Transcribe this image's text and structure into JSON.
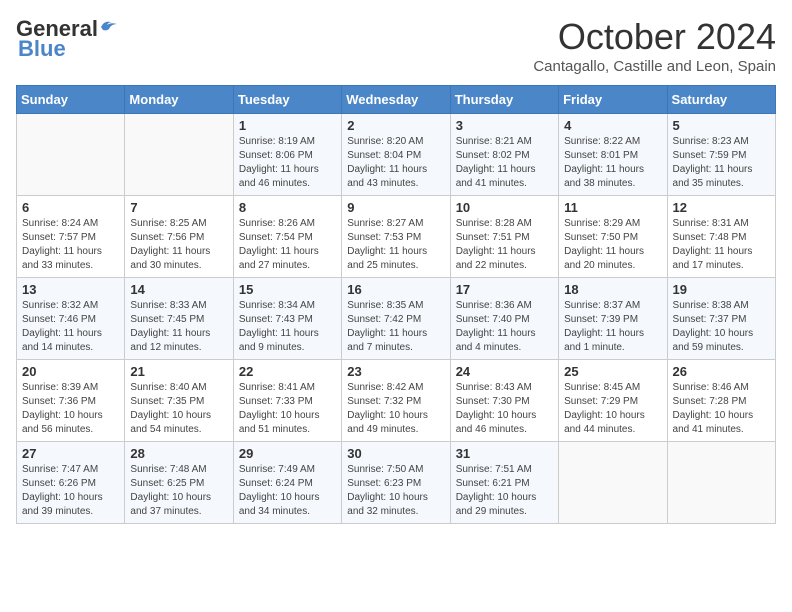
{
  "logo": {
    "general": "General",
    "blue": "Blue"
  },
  "title": "October 2024",
  "location": "Cantagallo, Castille and Leon, Spain",
  "days_of_week": [
    "Sunday",
    "Monday",
    "Tuesday",
    "Wednesday",
    "Thursday",
    "Friday",
    "Saturday"
  ],
  "weeks": [
    [
      {
        "day": "",
        "sunrise": "",
        "sunset": "",
        "daylight": ""
      },
      {
        "day": "",
        "sunrise": "",
        "sunset": "",
        "daylight": ""
      },
      {
        "day": "1",
        "sunrise": "Sunrise: 8:19 AM",
        "sunset": "Sunset: 8:06 PM",
        "daylight": "Daylight: 11 hours and 46 minutes."
      },
      {
        "day": "2",
        "sunrise": "Sunrise: 8:20 AM",
        "sunset": "Sunset: 8:04 PM",
        "daylight": "Daylight: 11 hours and 43 minutes."
      },
      {
        "day": "3",
        "sunrise": "Sunrise: 8:21 AM",
        "sunset": "Sunset: 8:02 PM",
        "daylight": "Daylight: 11 hours and 41 minutes."
      },
      {
        "day": "4",
        "sunrise": "Sunrise: 8:22 AM",
        "sunset": "Sunset: 8:01 PM",
        "daylight": "Daylight: 11 hours and 38 minutes."
      },
      {
        "day": "5",
        "sunrise": "Sunrise: 8:23 AM",
        "sunset": "Sunset: 7:59 PM",
        "daylight": "Daylight: 11 hours and 35 minutes."
      }
    ],
    [
      {
        "day": "6",
        "sunrise": "Sunrise: 8:24 AM",
        "sunset": "Sunset: 7:57 PM",
        "daylight": "Daylight: 11 hours and 33 minutes."
      },
      {
        "day": "7",
        "sunrise": "Sunrise: 8:25 AM",
        "sunset": "Sunset: 7:56 PM",
        "daylight": "Daylight: 11 hours and 30 minutes."
      },
      {
        "day": "8",
        "sunrise": "Sunrise: 8:26 AM",
        "sunset": "Sunset: 7:54 PM",
        "daylight": "Daylight: 11 hours and 27 minutes."
      },
      {
        "day": "9",
        "sunrise": "Sunrise: 8:27 AM",
        "sunset": "Sunset: 7:53 PM",
        "daylight": "Daylight: 11 hours and 25 minutes."
      },
      {
        "day": "10",
        "sunrise": "Sunrise: 8:28 AM",
        "sunset": "Sunset: 7:51 PM",
        "daylight": "Daylight: 11 hours and 22 minutes."
      },
      {
        "day": "11",
        "sunrise": "Sunrise: 8:29 AM",
        "sunset": "Sunset: 7:50 PM",
        "daylight": "Daylight: 11 hours and 20 minutes."
      },
      {
        "day": "12",
        "sunrise": "Sunrise: 8:31 AM",
        "sunset": "Sunset: 7:48 PM",
        "daylight": "Daylight: 11 hours and 17 minutes."
      }
    ],
    [
      {
        "day": "13",
        "sunrise": "Sunrise: 8:32 AM",
        "sunset": "Sunset: 7:46 PM",
        "daylight": "Daylight: 11 hours and 14 minutes."
      },
      {
        "day": "14",
        "sunrise": "Sunrise: 8:33 AM",
        "sunset": "Sunset: 7:45 PM",
        "daylight": "Daylight: 11 hours and 12 minutes."
      },
      {
        "day": "15",
        "sunrise": "Sunrise: 8:34 AM",
        "sunset": "Sunset: 7:43 PM",
        "daylight": "Daylight: 11 hours and 9 minutes."
      },
      {
        "day": "16",
        "sunrise": "Sunrise: 8:35 AM",
        "sunset": "Sunset: 7:42 PM",
        "daylight": "Daylight: 11 hours and 7 minutes."
      },
      {
        "day": "17",
        "sunrise": "Sunrise: 8:36 AM",
        "sunset": "Sunset: 7:40 PM",
        "daylight": "Daylight: 11 hours and 4 minutes."
      },
      {
        "day": "18",
        "sunrise": "Sunrise: 8:37 AM",
        "sunset": "Sunset: 7:39 PM",
        "daylight": "Daylight: 11 hours and 1 minute."
      },
      {
        "day": "19",
        "sunrise": "Sunrise: 8:38 AM",
        "sunset": "Sunset: 7:37 PM",
        "daylight": "Daylight: 10 hours and 59 minutes."
      }
    ],
    [
      {
        "day": "20",
        "sunrise": "Sunrise: 8:39 AM",
        "sunset": "Sunset: 7:36 PM",
        "daylight": "Daylight: 10 hours and 56 minutes."
      },
      {
        "day": "21",
        "sunrise": "Sunrise: 8:40 AM",
        "sunset": "Sunset: 7:35 PM",
        "daylight": "Daylight: 10 hours and 54 minutes."
      },
      {
        "day": "22",
        "sunrise": "Sunrise: 8:41 AM",
        "sunset": "Sunset: 7:33 PM",
        "daylight": "Daylight: 10 hours and 51 minutes."
      },
      {
        "day": "23",
        "sunrise": "Sunrise: 8:42 AM",
        "sunset": "Sunset: 7:32 PM",
        "daylight": "Daylight: 10 hours and 49 minutes."
      },
      {
        "day": "24",
        "sunrise": "Sunrise: 8:43 AM",
        "sunset": "Sunset: 7:30 PM",
        "daylight": "Daylight: 10 hours and 46 minutes."
      },
      {
        "day": "25",
        "sunrise": "Sunrise: 8:45 AM",
        "sunset": "Sunset: 7:29 PM",
        "daylight": "Daylight: 10 hours and 44 minutes."
      },
      {
        "day": "26",
        "sunrise": "Sunrise: 8:46 AM",
        "sunset": "Sunset: 7:28 PM",
        "daylight": "Daylight: 10 hours and 41 minutes."
      }
    ],
    [
      {
        "day": "27",
        "sunrise": "Sunrise: 7:47 AM",
        "sunset": "Sunset: 6:26 PM",
        "daylight": "Daylight: 10 hours and 39 minutes."
      },
      {
        "day": "28",
        "sunrise": "Sunrise: 7:48 AM",
        "sunset": "Sunset: 6:25 PM",
        "daylight": "Daylight: 10 hours and 37 minutes."
      },
      {
        "day": "29",
        "sunrise": "Sunrise: 7:49 AM",
        "sunset": "Sunset: 6:24 PM",
        "daylight": "Daylight: 10 hours and 34 minutes."
      },
      {
        "day": "30",
        "sunrise": "Sunrise: 7:50 AM",
        "sunset": "Sunset: 6:23 PM",
        "daylight": "Daylight: 10 hours and 32 minutes."
      },
      {
        "day": "31",
        "sunrise": "Sunrise: 7:51 AM",
        "sunset": "Sunset: 6:21 PM",
        "daylight": "Daylight: 10 hours and 29 minutes."
      },
      {
        "day": "",
        "sunrise": "",
        "sunset": "",
        "daylight": ""
      },
      {
        "day": "",
        "sunrise": "",
        "sunset": "",
        "daylight": ""
      }
    ]
  ]
}
